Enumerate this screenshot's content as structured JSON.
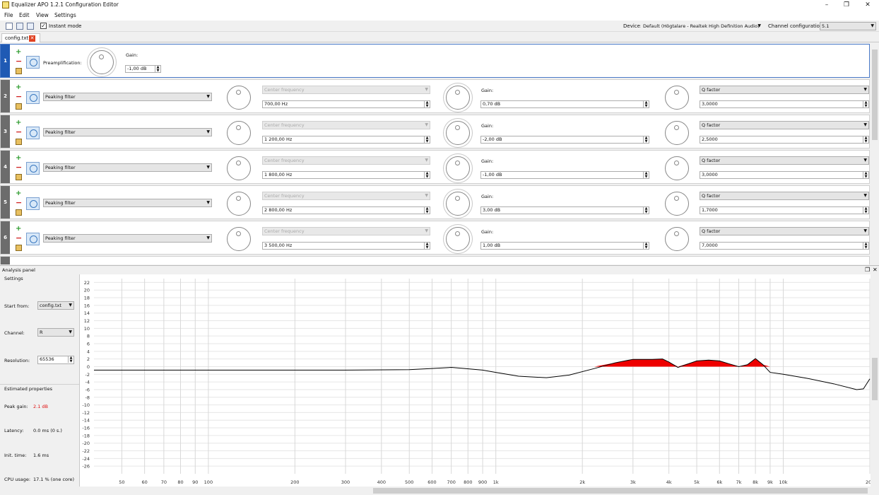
{
  "window": {
    "title": "Equalizer APO 1.2.1 Configuration Editor",
    "minimize_glyph": "–",
    "restore_glyph": "❐",
    "close_glyph": "✕"
  },
  "menu": {
    "file": "File",
    "edit": "Edit",
    "view": "View",
    "settings": "Settings"
  },
  "toolbar": {
    "new_icon": "new-file-icon",
    "open_icon": "open-folder-icon",
    "save_icon": "save-icon",
    "instant_mode_label": "Instant mode",
    "instant_mode_checked": true,
    "device_label": "Device:",
    "device_value": "Default (Högtalare - Realtek High Definition Audio)",
    "channel_config_label": "Channel configuration:",
    "channel_config_value": "5.1"
  },
  "tab": {
    "label": "config.txt",
    "close_glyph": "✕"
  },
  "preamp": {
    "index": "1",
    "label": "Preamplification:",
    "gain_label": "Gain:",
    "gain_value": "-1,00 dB"
  },
  "filters": [
    {
      "index": "2",
      "type": "Peaking filter",
      "freq_label": "Center frequency",
      "freq_value": "700,00 Hz",
      "gain_label": "Gain:",
      "gain_value": "0,70 dB",
      "q_label": "Q factor",
      "q_value": "3,0000"
    },
    {
      "index": "3",
      "type": "Peaking filter",
      "freq_label": "Center frequency",
      "freq_value": "1 200,00 Hz",
      "gain_label": "Gain:",
      "gain_value": "-2,00 dB",
      "q_label": "Q factor",
      "q_value": "2,5000"
    },
    {
      "index": "4",
      "type": "Peaking filter",
      "freq_label": "Center frequency",
      "freq_value": "1 800,00 Hz",
      "gain_label": "Gain:",
      "gain_value": "-1,00 dB",
      "q_label": "Q factor",
      "q_value": "3,0000"
    },
    {
      "index": "5",
      "type": "Peaking filter",
      "freq_label": "Center frequency",
      "freq_value": "2 800,00 Hz",
      "gain_label": "Gain:",
      "gain_value": "3,00 dB",
      "q_label": "Q factor",
      "q_value": "1,7000"
    },
    {
      "index": "6",
      "type": "Peaking filter",
      "freq_label": "Center frequency",
      "freq_value": "3 500,00 Hz",
      "gain_label": "Gain:",
      "gain_value": "1,00 dB",
      "q_label": "Q factor",
      "q_value": "7,0000"
    }
  ],
  "analysis": {
    "title": "Analysis panel",
    "settings_title": "Settings",
    "start_from_label": "Start from:",
    "start_from_value": "config.txt",
    "channel_label": "Channel:",
    "channel_value": "R",
    "resolution_label": "Resolution:",
    "resolution_value": "65536",
    "estimated_title": "Estimated properties",
    "peak_gain_label": "Peak gain:",
    "peak_gain_value": "2.1 dB",
    "peak_gain_color": "#e01010",
    "latency_label": "Latency:",
    "latency_value": "0.0 ms (0 s.)",
    "init_time_label": "Init. time:",
    "init_time_value": "1.6 ms",
    "cpu_label": "CPU usage:",
    "cpu_value": "17.1 % (one core)"
  },
  "chart_data": {
    "type": "line",
    "x_scale": "log",
    "xlim": [
      40,
      20000
    ],
    "ylim": [
      -28,
      23
    ],
    "y_ticks": [
      22,
      20,
      18,
      16,
      14,
      12,
      10,
      8,
      6,
      4,
      2,
      0,
      -2,
      -4,
      -6,
      -8,
      -10,
      -12,
      -14,
      -16,
      -18,
      -20,
      -22,
      -24,
      -26
    ],
    "x_ticks": [
      {
        "v": 50,
        "label": "50"
      },
      {
        "v": 60,
        "label": "60"
      },
      {
        "v": 70,
        "label": "70"
      },
      {
        "v": 80,
        "label": "80"
      },
      {
        "v": 90,
        "label": "90"
      },
      {
        "v": 100,
        "label": "100"
      },
      {
        "v": 200,
        "label": "200"
      },
      {
        "v": 300,
        "label": "300"
      },
      {
        "v": 400,
        "label": "400"
      },
      {
        "v": 500,
        "label": "500"
      },
      {
        "v": 600,
        "label": "600"
      },
      {
        "v": 700,
        "label": "700"
      },
      {
        "v": 800,
        "label": "800"
      },
      {
        "v": 900,
        "label": "900"
      },
      {
        "v": 1000,
        "label": "1k"
      },
      {
        "v": 2000,
        "label": "2k"
      },
      {
        "v": 3000,
        "label": "3k"
      },
      {
        "v": 4000,
        "label": "4k"
      },
      {
        "v": 5000,
        "label": "5k"
      },
      {
        "v": 6000,
        "label": "6k"
      },
      {
        "v": 7000,
        "label": "7k"
      },
      {
        "v": 8000,
        "label": "8k"
      },
      {
        "v": 9000,
        "label": "9k"
      },
      {
        "v": 10000,
        "label": "10k"
      },
      {
        "v": 20000,
        "label": "20k"
      }
    ],
    "series": [
      {
        "line_color": "#000000",
        "fill_above_zero_color": "#ee0000",
        "x": [
          40,
          100,
          300,
          500,
          600,
          700,
          900,
          1000,
          1200,
          1500,
          1800,
          2200,
          2600,
          3000,
          3500,
          3800,
          4000,
          4300,
          5000,
          5500,
          6000,
          6500,
          7000,
          7500,
          8000,
          8500,
          9000,
          10000,
          12000,
          15000,
          18000,
          19000,
          20000
        ],
        "y": [
          -0.9,
          -0.9,
          -0.9,
          -0.8,
          -0.5,
          -0.2,
          -0.9,
          -1.5,
          -2.5,
          -2.9,
          -2.2,
          -0.5,
          1.0,
          1.9,
          1.9,
          2.0,
          1.2,
          -0.2,
          1.5,
          1.7,
          1.5,
          0.7,
          0.0,
          0.5,
          2.1,
          0.5,
          -1.5,
          -2.0,
          -3.0,
          -4.5,
          -6.0,
          -5.8,
          -3.2
        ]
      }
    ]
  }
}
